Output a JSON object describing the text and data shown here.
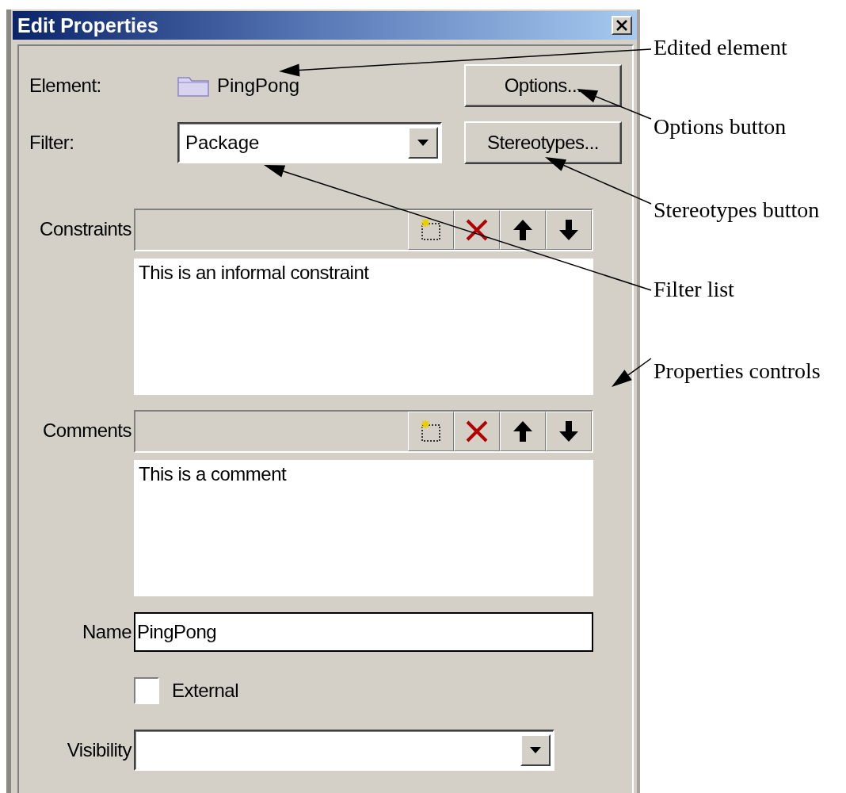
{
  "window": {
    "title": "Edit Properties"
  },
  "element": {
    "label": "Element:",
    "value": "PingPong"
  },
  "options_button": "Options...",
  "filter": {
    "label": "Filter:",
    "value": "Package"
  },
  "stereotypes_button": "Stereotypes...",
  "lists": [
    {
      "label": "Constraints",
      "text": "This is an informal constraint"
    },
    {
      "label": "Comments",
      "text": "This is a comment"
    }
  ],
  "name": {
    "label": "Name",
    "value": "PingPong"
  },
  "external": {
    "label": "External",
    "checked": false
  },
  "visibility": {
    "label": "Visibility"
  },
  "callouts": [
    {
      "text": "Edited element"
    },
    {
      "text": "Options button"
    },
    {
      "text": "Stereotypes button"
    },
    {
      "text": "Filter list"
    },
    {
      "text": "Properties controls"
    }
  ]
}
